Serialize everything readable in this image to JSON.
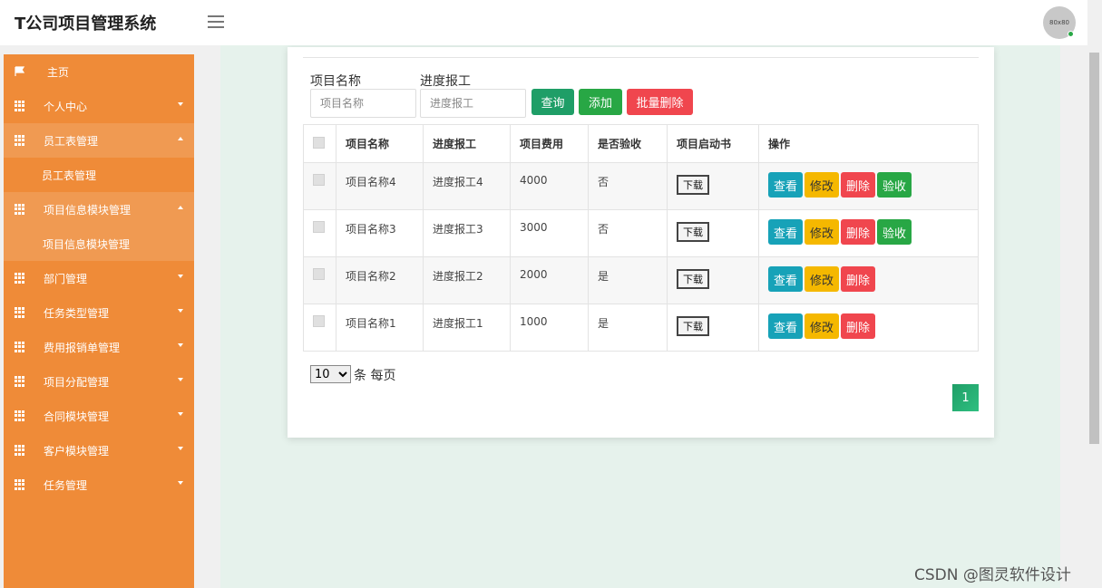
{
  "header": {
    "brand": "T公司项目管理系统",
    "avatar_text": "80x80"
  },
  "sidebar": {
    "items": [
      {
        "label": "主页",
        "icon": "flag-icon"
      },
      {
        "label": "个人中心",
        "icon": "grid-icon"
      },
      {
        "label": "员工表管理",
        "icon": "grid-icon",
        "open": true
      },
      {
        "label": "员工表管理",
        "sub": true
      },
      {
        "label": "项目信息模块管理",
        "icon": "grid-icon",
        "open": true
      },
      {
        "label": "项目信息模块管理",
        "sub": true
      },
      {
        "label": "部门管理",
        "icon": "grid-icon"
      },
      {
        "label": "任务类型管理",
        "icon": "grid-icon"
      },
      {
        "label": "费用报销单管理",
        "icon": "grid-icon"
      },
      {
        "label": "项目分配管理",
        "icon": "grid-icon"
      },
      {
        "label": "合同模块管理",
        "icon": "grid-icon"
      },
      {
        "label": "客户模块管理",
        "icon": "grid-icon"
      },
      {
        "label": "任务管理",
        "icon": "grid-icon"
      }
    ]
  },
  "search": {
    "name_label": "项目名称",
    "name_placeholder": "项目名称",
    "progress_label": "进度报工",
    "progress_placeholder": "进度报工",
    "query_btn": "查询",
    "add_btn": "添加",
    "batch_delete_btn": "批量删除"
  },
  "table": {
    "headers": [
      "项目名称",
      "进度报工",
      "项目费用",
      "是否验收",
      "项目启动书",
      "操作"
    ],
    "rows": [
      {
        "name": "项目名称4",
        "progress": "进度报工4",
        "cost": "4000",
        "accepted": "否",
        "download": "下载"
      },
      {
        "name": "项目名称3",
        "progress": "进度报工3",
        "cost": "3000",
        "accepted": "否",
        "download": "下载"
      },
      {
        "name": "项目名称2",
        "progress": "进度报工2",
        "cost": "2000",
        "accepted": "是",
        "download": "下载"
      },
      {
        "name": "项目名称1",
        "progress": "进度报工1",
        "cost": "1000",
        "accepted": "是",
        "download": "下载"
      }
    ],
    "actions": {
      "view": "查看",
      "edit": "修改",
      "delete": "删除",
      "accept": "验收"
    }
  },
  "pager": {
    "page_size": "10",
    "per_page_text": "条 每页",
    "current_page": "1"
  },
  "watermark": "CSDN @图灵软件设计",
  "colors": {
    "sidebar": "#ef8b38",
    "primary_green": "#1f9e67",
    "danger": "#f0464e",
    "warning": "#f5b800",
    "info": "#17a2b8"
  }
}
